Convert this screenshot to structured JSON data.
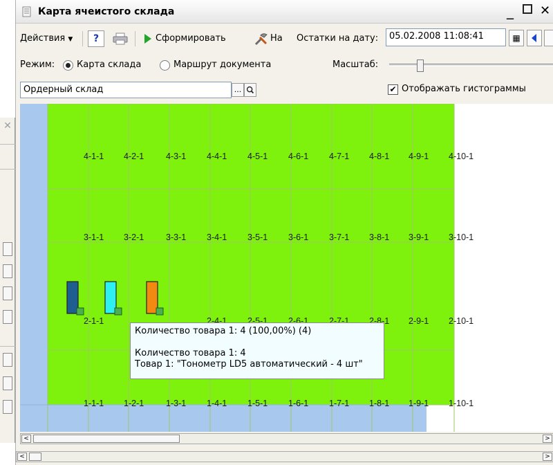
{
  "window": {
    "title": "Карта ячеистого склада"
  },
  "toolbar": {
    "actions_label": "Действия",
    "help_label": "?",
    "form_label": "Сформировать",
    "na_label": "На",
    "balance_date_label": "Остатки на дату:",
    "balance_date_value": "05.02.2008 11:08:41"
  },
  "mode": {
    "label": "Режим:",
    "option_map": "Карта склада",
    "option_route": "Маршрут документа",
    "selected": "Карта склада",
    "scale_label": "Масштаб:",
    "scale_level": 0.18
  },
  "warehouse": {
    "value": "Ордерный склад",
    "more_label": "...",
    "show_histograms_label": "Отображать гистограммы",
    "show_histograms": true
  },
  "map": {
    "colors": {
      "green": "#7ef10c",
      "blue": "#a8c8ee",
      "white": "#ffffff"
    },
    "rows": [
      [
        "4-1-1",
        "4-2-1",
        "4-3-1",
        "4-4-1",
        "4-5-1",
        "4-6-1",
        "4-7-1",
        "4-8-1",
        "4-9-1",
        "4-10-1"
      ],
      [
        "3-1-1",
        "3-2-1",
        "3-3-1",
        "3-4-1",
        "3-5-1",
        "3-6-1",
        "3-7-1",
        "3-8-1",
        "3-9-1",
        "3-10-1"
      ],
      [
        "2-1-1",
        "",
        "",
        "2-4-1",
        "2-5-1",
        "2-6-1",
        "2-7-1",
        "2-8-1",
        "2-9-1",
        "2-10-1"
      ],
      [
        "1-1-1",
        "1-2-1",
        "1-3-1",
        "1-4-1",
        "1-5-1",
        "1-6-1",
        "1-7-1",
        "1-8-1",
        "1-9-1",
        "1-10-1"
      ]
    ],
    "histograms": [
      {
        "cell": "2-1-1",
        "color": "#1f5f8f",
        "fill": 1.0
      },
      {
        "cell": "2-2-1",
        "color": "#2ef0f0",
        "fill": 1.0
      },
      {
        "cell": "2-3-1",
        "color": "#f28a12",
        "fill": 1.0
      }
    ]
  },
  "tooltip": {
    "line1": "Количество товара 1: 4 (100,00%) (4)",
    "line2": "Количество товара 1: 4",
    "line3": "Товар 1: \"Тонометр LD5 автоматический - 4 шт\""
  }
}
